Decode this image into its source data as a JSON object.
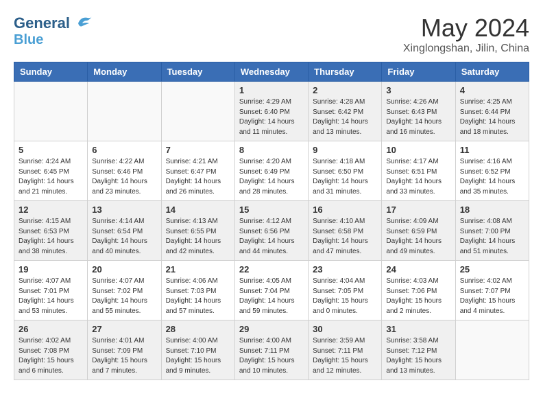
{
  "header": {
    "logo_line1": "General",
    "logo_line2": "Blue",
    "month_year": "May 2024",
    "location": "Xinglongshan, Jilin, China"
  },
  "weekdays": [
    "Sunday",
    "Monday",
    "Tuesday",
    "Wednesday",
    "Thursday",
    "Friday",
    "Saturday"
  ],
  "weeks": [
    [
      {
        "day": "",
        "info": "",
        "empty": true
      },
      {
        "day": "",
        "info": "",
        "empty": true
      },
      {
        "day": "",
        "info": "",
        "empty": true
      },
      {
        "day": "1",
        "info": "Sunrise: 4:29 AM\nSunset: 6:40 PM\nDaylight: 14 hours\nand 11 minutes."
      },
      {
        "day": "2",
        "info": "Sunrise: 4:28 AM\nSunset: 6:42 PM\nDaylight: 14 hours\nand 13 minutes."
      },
      {
        "day": "3",
        "info": "Sunrise: 4:26 AM\nSunset: 6:43 PM\nDaylight: 14 hours\nand 16 minutes."
      },
      {
        "day": "4",
        "info": "Sunrise: 4:25 AM\nSunset: 6:44 PM\nDaylight: 14 hours\nand 18 minutes."
      }
    ],
    [
      {
        "day": "5",
        "info": "Sunrise: 4:24 AM\nSunset: 6:45 PM\nDaylight: 14 hours\nand 21 minutes."
      },
      {
        "day": "6",
        "info": "Sunrise: 4:22 AM\nSunset: 6:46 PM\nDaylight: 14 hours\nand 23 minutes."
      },
      {
        "day": "7",
        "info": "Sunrise: 4:21 AM\nSunset: 6:47 PM\nDaylight: 14 hours\nand 26 minutes."
      },
      {
        "day": "8",
        "info": "Sunrise: 4:20 AM\nSunset: 6:49 PM\nDaylight: 14 hours\nand 28 minutes."
      },
      {
        "day": "9",
        "info": "Sunrise: 4:18 AM\nSunset: 6:50 PM\nDaylight: 14 hours\nand 31 minutes."
      },
      {
        "day": "10",
        "info": "Sunrise: 4:17 AM\nSunset: 6:51 PM\nDaylight: 14 hours\nand 33 minutes."
      },
      {
        "day": "11",
        "info": "Sunrise: 4:16 AM\nSunset: 6:52 PM\nDaylight: 14 hours\nand 35 minutes."
      }
    ],
    [
      {
        "day": "12",
        "info": "Sunrise: 4:15 AM\nSunset: 6:53 PM\nDaylight: 14 hours\nand 38 minutes."
      },
      {
        "day": "13",
        "info": "Sunrise: 4:14 AM\nSunset: 6:54 PM\nDaylight: 14 hours\nand 40 minutes."
      },
      {
        "day": "14",
        "info": "Sunrise: 4:13 AM\nSunset: 6:55 PM\nDaylight: 14 hours\nand 42 minutes."
      },
      {
        "day": "15",
        "info": "Sunrise: 4:12 AM\nSunset: 6:56 PM\nDaylight: 14 hours\nand 44 minutes."
      },
      {
        "day": "16",
        "info": "Sunrise: 4:10 AM\nSunset: 6:58 PM\nDaylight: 14 hours\nand 47 minutes."
      },
      {
        "day": "17",
        "info": "Sunrise: 4:09 AM\nSunset: 6:59 PM\nDaylight: 14 hours\nand 49 minutes."
      },
      {
        "day": "18",
        "info": "Sunrise: 4:08 AM\nSunset: 7:00 PM\nDaylight: 14 hours\nand 51 minutes."
      }
    ],
    [
      {
        "day": "19",
        "info": "Sunrise: 4:07 AM\nSunset: 7:01 PM\nDaylight: 14 hours\nand 53 minutes."
      },
      {
        "day": "20",
        "info": "Sunrise: 4:07 AM\nSunset: 7:02 PM\nDaylight: 14 hours\nand 55 minutes."
      },
      {
        "day": "21",
        "info": "Sunrise: 4:06 AM\nSunset: 7:03 PM\nDaylight: 14 hours\nand 57 minutes."
      },
      {
        "day": "22",
        "info": "Sunrise: 4:05 AM\nSunset: 7:04 PM\nDaylight: 14 hours\nand 59 minutes."
      },
      {
        "day": "23",
        "info": "Sunrise: 4:04 AM\nSunset: 7:05 PM\nDaylight: 15 hours\nand 0 minutes."
      },
      {
        "day": "24",
        "info": "Sunrise: 4:03 AM\nSunset: 7:06 PM\nDaylight: 15 hours\nand 2 minutes."
      },
      {
        "day": "25",
        "info": "Sunrise: 4:02 AM\nSunset: 7:07 PM\nDaylight: 15 hours\nand 4 minutes."
      }
    ],
    [
      {
        "day": "26",
        "info": "Sunrise: 4:02 AM\nSunset: 7:08 PM\nDaylight: 15 hours\nand 6 minutes."
      },
      {
        "day": "27",
        "info": "Sunrise: 4:01 AM\nSunset: 7:09 PM\nDaylight: 15 hours\nand 7 minutes."
      },
      {
        "day": "28",
        "info": "Sunrise: 4:00 AM\nSunset: 7:10 PM\nDaylight: 15 hours\nand 9 minutes."
      },
      {
        "day": "29",
        "info": "Sunrise: 4:00 AM\nSunset: 7:11 PM\nDaylight: 15 hours\nand 10 minutes."
      },
      {
        "day": "30",
        "info": "Sunrise: 3:59 AM\nSunset: 7:11 PM\nDaylight: 15 hours\nand 12 minutes."
      },
      {
        "day": "31",
        "info": "Sunrise: 3:58 AM\nSunset: 7:12 PM\nDaylight: 15 hours\nand 13 minutes."
      },
      {
        "day": "",
        "info": "",
        "empty": true
      }
    ]
  ]
}
